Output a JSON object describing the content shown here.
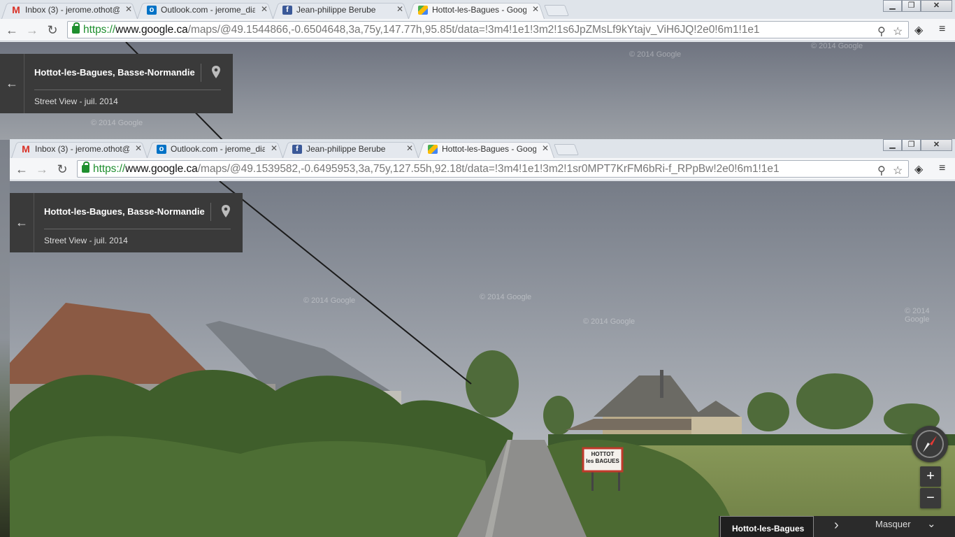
{
  "back_window": {
    "tabs": [
      {
        "title": "Inbox (3) - jerome.othot@",
        "icon": "gmail-icon"
      },
      {
        "title": "Outlook.com - jerome_dia",
        "icon": "outlook-icon"
      },
      {
        "title": "Jean-philippe Berube",
        "icon": "facebook-icon"
      },
      {
        "title": "Hottot-les-Bagues - Goog",
        "icon": "maps-icon"
      }
    ],
    "url_scheme": "https://",
    "url_host": "www.google.ca",
    "url_path": "/maps/@49.1544866,-0.6504648,3a,75y,147.77h,95.85t/data=!3m4!1e1!3m2!1s6JpZMsLf9kYtajv_ViH6JQ!2e0!6m1!1e1",
    "card": {
      "place": "Hottot-les-Bagues, Basse-Normandie",
      "sub": "Street View - juil. 2014"
    }
  },
  "front_window": {
    "tabs": [
      {
        "title": "Inbox (3) - jerome.othot@",
        "icon": "gmail-icon"
      },
      {
        "title": "Outlook.com - jerome_dia",
        "icon": "outlook-icon"
      },
      {
        "title": "Jean-philippe Berube",
        "icon": "facebook-icon"
      },
      {
        "title": "Hottot-les-Bagues - Goog",
        "icon": "maps-icon"
      }
    ],
    "url_scheme": "https://",
    "url_host": "www.google.ca",
    "url_path": "/maps/@49.1539582,-0.6495953,3a,75y,127.55h,92.18t/data=!3m4!1e1!3m2!1sr0MPT7KrFM6bRi-f_RPpBw!2e0!6m1!1e1",
    "card": {
      "place": "Hottot-les-Bagues, Basse-Normandie",
      "sub": "Street View - juil. 2014"
    }
  },
  "panorama": {
    "watermark": "© 2014 Google",
    "road_sign_line1": "HOTTOT",
    "road_sign_line2": "les BAGUES"
  },
  "controls": {
    "zoom_in": "+",
    "zoom_out": "−"
  },
  "bottom_bar": {
    "place": "Hottot-les-Bagues",
    "hide_label": "Masquer"
  },
  "colors": {
    "gmail": "#d93025",
    "outlook": "#0072c6",
    "facebook": "#3b5998",
    "lock_green": "#1f8f2f"
  }
}
